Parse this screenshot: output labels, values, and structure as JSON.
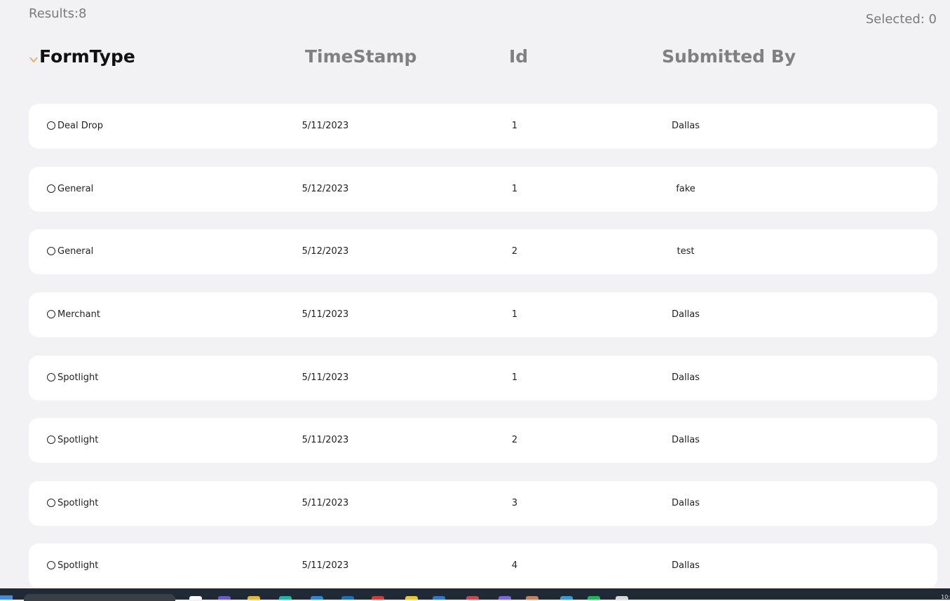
{
  "results_label": "Results:8",
  "selected_label": "Selected: 0",
  "columns": {
    "formtype": "FormType",
    "timestamp": "TimeStamp",
    "id": "Id",
    "submitted_by": "Submitted By"
  },
  "sort": {
    "column": "FormType",
    "direction": "descending",
    "icon": "chevron-down-icon",
    "color": "#e8a44a"
  },
  "rows": [
    {
      "formtype": "Deal Drop",
      "timestamp": "5/11/2023",
      "id": "1",
      "submitted_by": "Dallas"
    },
    {
      "formtype": "General",
      "timestamp": "5/12/2023",
      "id": "1",
      "submitted_by": "fake"
    },
    {
      "formtype": "General",
      "timestamp": "5/12/2023",
      "id": "2",
      "submitted_by": "test"
    },
    {
      "formtype": "Merchant",
      "timestamp": "5/11/2023",
      "id": "1",
      "submitted_by": "Dallas"
    },
    {
      "formtype": "Spotlight",
      "timestamp": "5/11/2023",
      "id": "1",
      "submitted_by": "Dallas"
    },
    {
      "formtype": "Spotlight",
      "timestamp": "5/11/2023",
      "id": "2",
      "submitted_by": "Dallas"
    },
    {
      "formtype": "Spotlight",
      "timestamp": "5/11/2023",
      "id": "3",
      "submitted_by": "Dallas"
    },
    {
      "formtype": "Spotlight",
      "timestamp": "5/11/2023",
      "id": "4",
      "submitted_by": "Dallas"
    }
  ],
  "taskbar": {
    "clock": "10:",
    "icons": [
      "start-icon",
      "search-box",
      "file-explorer-icon",
      "app-icon",
      "folder-icon",
      "edge-icon",
      "store-icon",
      "app-icon",
      "chrome-icon",
      "app-icon",
      "vscode-icon",
      "app-icon",
      "teams-icon",
      "app-icon",
      "app-icon",
      "spotify-icon",
      "app-icon"
    ]
  }
}
